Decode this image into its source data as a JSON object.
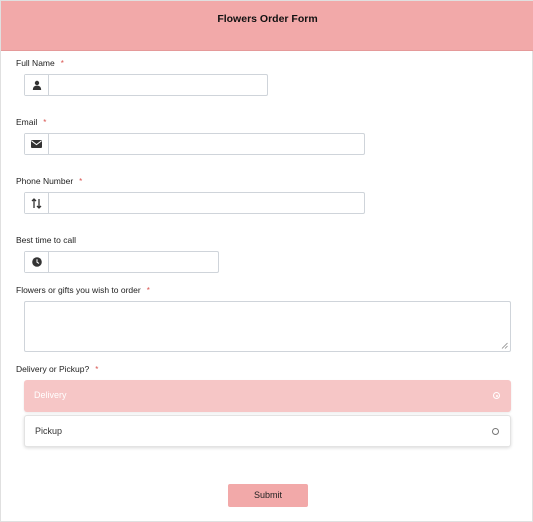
{
  "header": {
    "title": "Flowers Order Form"
  },
  "required_mark": "*",
  "fields": {
    "full_name": {
      "label": "Full Name",
      "value": "",
      "icon": "user-icon"
    },
    "email": {
      "label": "Email",
      "value": "",
      "icon": "envelope-icon"
    },
    "phone": {
      "label": "Phone Number",
      "value": "",
      "icon": "sort-arrows-icon"
    },
    "best_time": {
      "label": "Best time to call",
      "value": "",
      "icon": "clock-icon"
    },
    "flowers": {
      "label": "Flowers or gifts you wish to order",
      "value": ""
    }
  },
  "delivery": {
    "label": "Delivery or Pickup?",
    "options": [
      {
        "label": "Delivery",
        "selected": true
      },
      {
        "label": "Pickup",
        "selected": false
      }
    ]
  },
  "submit": {
    "label": "Submit"
  },
  "colors": {
    "accent": "#f2a9a9",
    "selected_option": "#f6c6c6",
    "required": "#d9534f"
  }
}
